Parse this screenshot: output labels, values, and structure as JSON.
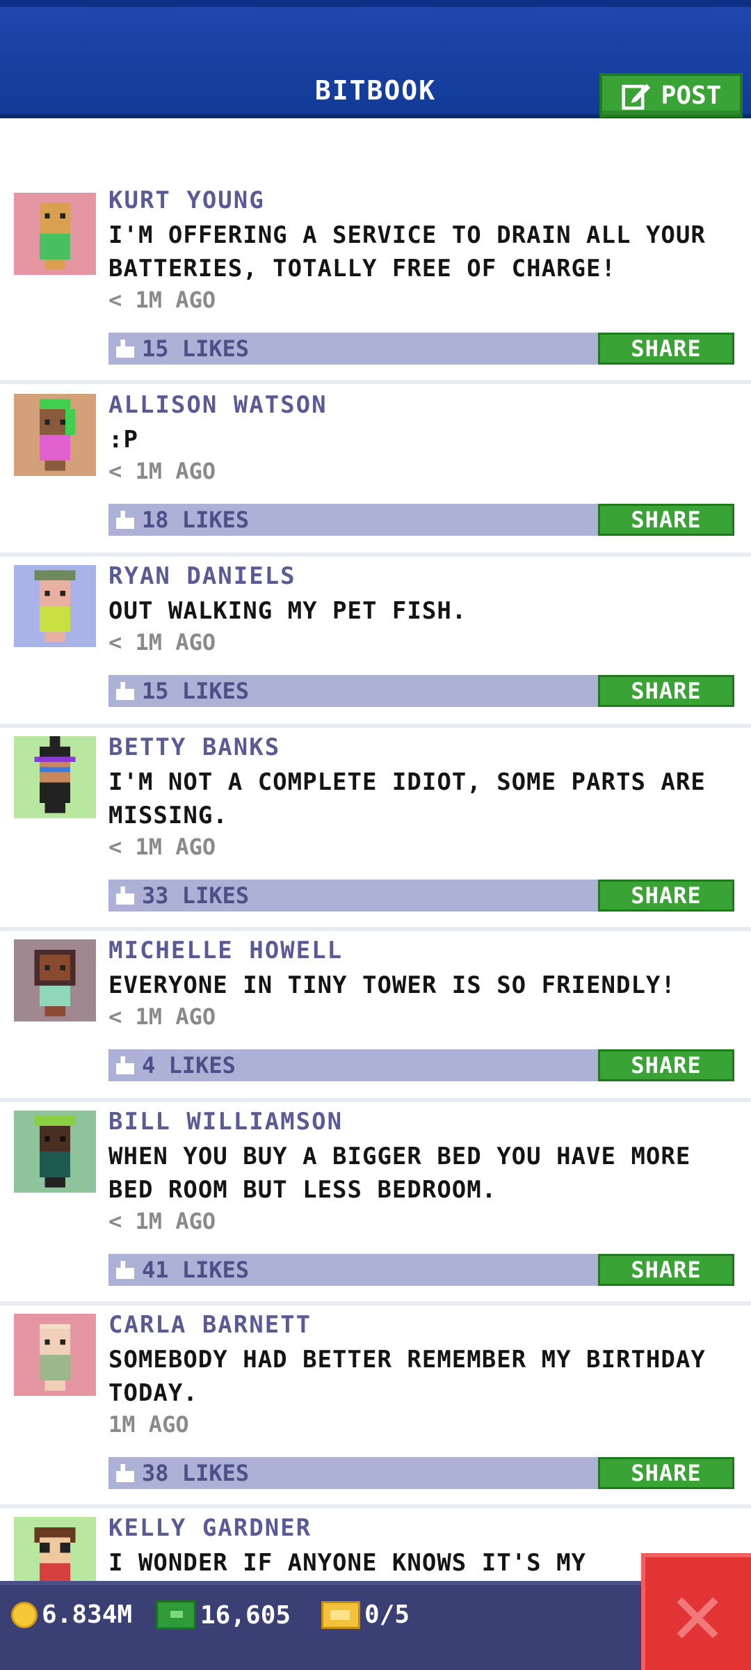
{
  "header": {
    "title": "BITBOOK",
    "post_label": "POST"
  },
  "posts": [
    {
      "author": "KURT YOUNG",
      "message": "I'M OFFERING A SERVICE TO DRAIN ALL YOUR BATTERIES, TOTALLY FREE OF CHARGE!",
      "time": "< 1M AGO",
      "likes": "15 LIKES",
      "share": "SHARE",
      "avatar_bg": "#e596a3"
    },
    {
      "author": "ALLISON WATSON",
      "message": ":P",
      "time": "< 1M AGO",
      "likes": "18 LIKES",
      "share": "SHARE",
      "avatar_bg": "#d4a079"
    },
    {
      "author": "RYAN DANIELS",
      "message": "OUT WALKING MY PET FISH.",
      "time": "< 1M AGO",
      "likes": "15 LIKES",
      "share": "SHARE",
      "avatar_bg": "#aab3e8"
    },
    {
      "author": "BETTY BANKS",
      "message": "I'M NOT A COMPLETE IDIOT, SOME PARTS ARE MISSING.",
      "time": "< 1M AGO",
      "likes": "33 LIKES",
      "share": "SHARE",
      "avatar_bg": "#b8e8a0"
    },
    {
      "author": "MICHELLE HOWELL",
      "message": "EVERYONE IN TINY TOWER IS SO FRIENDLY!",
      "time": "< 1M AGO",
      "likes": "4 LIKES",
      "share": "SHARE",
      "avatar_bg": "#a08890"
    },
    {
      "author": "BILL WILLIAMSON",
      "message": "WHEN YOU BUY A BIGGER BED YOU HAVE MORE BED ROOM BUT LESS BEDROOM.",
      "time": "< 1M AGO",
      "likes": "41 LIKES",
      "share": "SHARE",
      "avatar_bg": "#8fc39c"
    },
    {
      "author": "CARLA BARNETT",
      "message": "SOMEBODY HAD BETTER REMEMBER MY BIRTHDAY TODAY.",
      "time": "1M AGO",
      "likes": "38 LIKES",
      "share": "SHARE",
      "avatar_bg": "#e596a3"
    },
    {
      "author": "KELLY GARDNER",
      "message": "I WONDER IF ANYONE KNOWS IT'S MY",
      "time": "",
      "likes": "",
      "share": "",
      "avatar_bg": "#b8e8a0"
    }
  ],
  "status": {
    "coins": "6.834M",
    "bux": "16,605",
    "tickets": "0/5"
  },
  "colors": {
    "header_blue": "#1f47ad",
    "green": "#3aa335",
    "like_bar": "#adb1d6",
    "author_text": "#5a5b94",
    "bottom_bar": "#3a3f74",
    "close_red": "#e23434"
  }
}
